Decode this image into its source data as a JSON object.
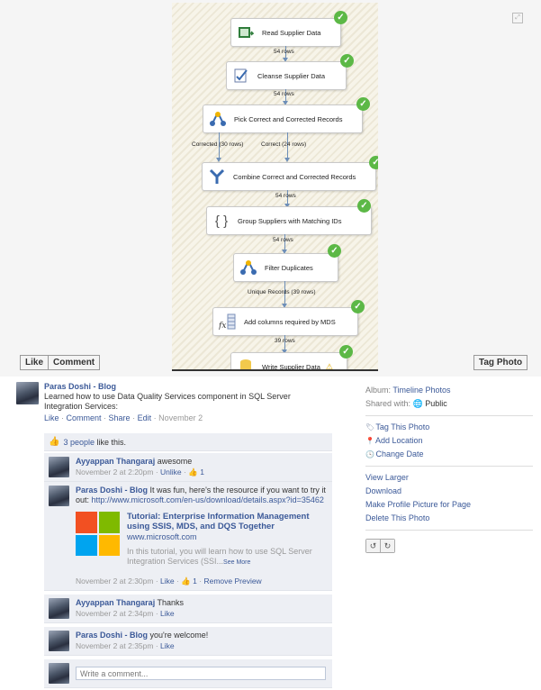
{
  "photo": {
    "nodes": [
      {
        "label": "Read Supplier Data"
      },
      {
        "label": "Cleanse Supplier Data"
      },
      {
        "label": "Pick Correct and Corrected Records"
      },
      {
        "label": "Combine Correct and Corrected Records"
      },
      {
        "label": "Group Suppliers with Matching IDs"
      },
      {
        "label": "Filter Duplicates"
      },
      {
        "label": "Add columns required by MDS"
      },
      {
        "label": "Write Supplier Data"
      }
    ],
    "flow_labels": {
      "f1": "54 rows",
      "f2": "54 rows",
      "corrected": "Corrected (30 rows)",
      "correct": "Correct (24 rows)",
      "f4": "54 rows",
      "f5": "54 rows",
      "unique": "Unique Records (39 rows)",
      "f7": "39 rows"
    }
  },
  "buttons": {
    "like": "Like",
    "comment": "Comment",
    "tag_photo": "Tag Photo"
  },
  "post": {
    "author": "Paras Doshi - Blog",
    "text": "Learned how to use Data Quality Services component in SQL Server Integration Services:",
    "actions": {
      "like": "Like",
      "comment": "Comment",
      "share": "Share",
      "edit": "Edit",
      "date": "November 2"
    }
  },
  "likes": {
    "count_text": "3 people",
    "suffix": "like this."
  },
  "comments": [
    {
      "author": "Ayyappan Thangaraj",
      "text": "awesome",
      "time": "November 2 at 2:20pm",
      "unlike": "Unlike",
      "likes": "1"
    },
    {
      "author": "Paras Doshi - Blog",
      "text": "It was fun, here's the resource if you want to try it out: ",
      "link": "http://www.microsoft.com/en-us/download/details.aspx?id=35462",
      "card": {
        "title": "Tutorial: Enterprise Information Management using SSIS, MDS, and DQS Together",
        "domain": "www.microsoft.com",
        "desc": "In this tutorial, you will learn how to use SQL Server Integration Services (SSI...",
        "see_more": "See More"
      },
      "time": "November 2 at 2:30pm",
      "like": "Like",
      "likes": "1",
      "remove": "Remove Preview"
    },
    {
      "author": "Ayyappan Thangaraj",
      "text": "Thanks",
      "time": "November 2 at 2:34pm",
      "like": "Like"
    },
    {
      "author": "Paras Doshi - Blog",
      "text": "you're welcome!",
      "time": "November 2 at 2:35pm",
      "like": "Like"
    }
  ],
  "write_placeholder": "Write a comment...",
  "sidebar": {
    "album_label": "Album:",
    "album_value": "Timeline Photos",
    "shared_label": "Shared with:",
    "shared_value": "Public",
    "tag": "Tag This Photo",
    "location": "Add Location",
    "date": "Change Date",
    "view_larger": "View Larger",
    "download": "Download",
    "profile_pic": "Make Profile Picture for Page",
    "delete": "Delete This Photo"
  },
  "colors": {
    "link": "#3b5998",
    "check": "#5cb846",
    "comment_bg": "#edeff4"
  }
}
